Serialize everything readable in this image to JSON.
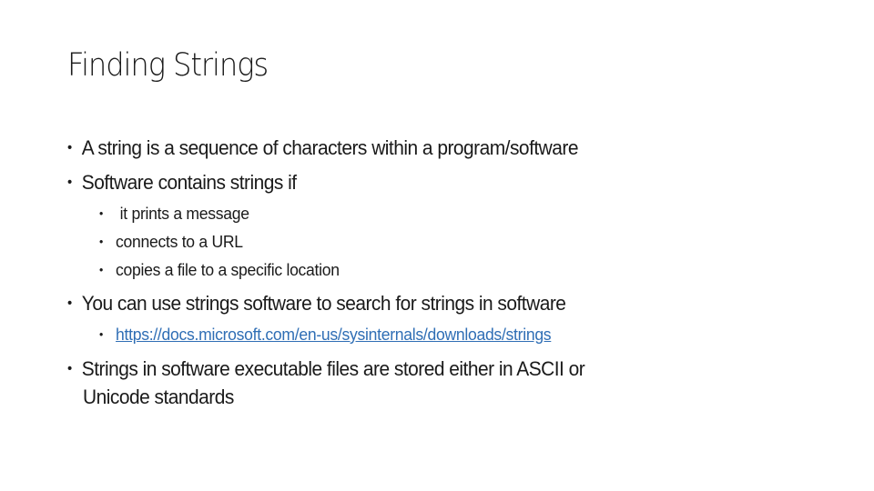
{
  "slide": {
    "title": "Finding Strings",
    "bullet_glyph": "•",
    "bullets": [
      {
        "text": "A string is a sequence of characters within a program/software"
      },
      {
        "text": "Software contains strings if",
        "sub": [
          {
            "text": " it prints a message"
          },
          {
            "text": "connects to a URL"
          },
          {
            "text": "copies a file to a specific location"
          }
        ]
      },
      {
        "text": "You can use strings software to search for strings in software",
        "sub": [
          {
            "text": "https://docs.microsoft.com/en-us/sysinternals/downloads/strings",
            "is_link": true
          }
        ]
      },
      {
        "text": "Strings in software executable files are stored either in ASCII or",
        "continuation": "Unicode standards"
      }
    ],
    "link_color": "#2f6eb5"
  }
}
